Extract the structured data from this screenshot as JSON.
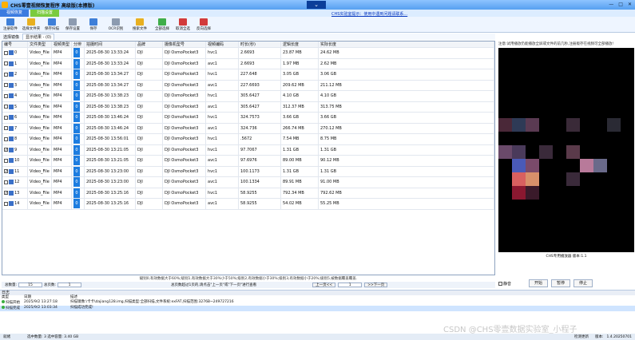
{
  "window": {
    "title": "CHS零壹视频恢复程序 高级版(本擦版)",
    "dropdown_glyph": "⌄",
    "controls": [
      "—",
      "□",
      "✕"
    ]
  },
  "menu": {
    "tabs": [
      "视频恢复",
      "扫描设置"
    ]
  },
  "notice": "CHS实验室提示：使用中遇到问题请联系...",
  "toolbar": {
    "buttons": [
      {
        "label": "注册软件",
        "icon": "key-icon",
        "color": "#3e7fd8"
      },
      {
        "label": "选择文件夹",
        "icon": "folder-icon",
        "color": "#e8b020"
      },
      {
        "label": "保存扫描",
        "icon": "save-icon",
        "color": "#3e7fd8"
      },
      {
        "label": "保存设置",
        "icon": "settings-icon",
        "color": "#8c9bb0"
      },
      {
        "label": "保存",
        "icon": "disk-icon",
        "color": "#3e7fd8"
      },
      {
        "label": "OCR识别",
        "icon": "ocr-icon",
        "color": "#8c9bb0"
      },
      {
        "label": "搜索文件",
        "icon": "search-icon",
        "color": "#e8b020"
      },
      {
        "label": "全部选择",
        "icon": "check-all-icon",
        "color": "#3fae4a"
      },
      {
        "label": "取消全选",
        "icon": "uncheck-icon",
        "color": "#d23b3b"
      },
      {
        "label": "反向选择",
        "icon": "invert-icon",
        "color": "#d23b3b"
      }
    ]
  },
  "subtabs": [
    "选择镜像",
    "显示结果 - (0)"
  ],
  "table": {
    "columns": [
      "编号",
      "文件类型",
      "视频类型",
      "分辨",
      "拍摄时间",
      "品牌",
      "摄像机型号",
      "视频编码",
      "时长(秒)",
      "逻辑长度",
      "实际长度"
    ],
    "rows": [
      {
        "id": "0",
        "checked": false,
        "ftype": "Video_File",
        "vtype": "MP4",
        "res": "0",
        "time": "2025-08-30 13:33:24",
        "brand": "DJI",
        "model": "DJI OsmoPocket3",
        "codec": "hvc1",
        "dur": "2.6693",
        "logical": "23.87 MB",
        "actual": "24.62 MB"
      },
      {
        "id": "1",
        "checked": false,
        "ftype": "Video_File",
        "vtype": "MP4",
        "res": "0",
        "time": "2025-08-30 13:33:24",
        "brand": "DJI",
        "model": "DJI OsmoPocket3",
        "codec": "avc1",
        "dur": "2.6693",
        "logical": "1.97 MB",
        "actual": "2.62 MB"
      },
      {
        "id": "2",
        "checked": false,
        "ftype": "Video_File",
        "vtype": "MP4",
        "res": "0",
        "time": "2025-08-30 13:34:27",
        "brand": "DJI",
        "model": "DJI OsmoPocket3",
        "codec": "hvc1",
        "dur": "227.648",
        "logical": "3.05 GB",
        "actual": "3.06 GB"
      },
      {
        "id": "3",
        "checked": false,
        "ftype": "Video_File",
        "vtype": "MP4",
        "res": "0",
        "time": "2025-08-30 13:34:27",
        "brand": "DJI",
        "model": "DJI OsmoPocket3",
        "codec": "avc1",
        "dur": "227.6693",
        "logical": "209.62 MB",
        "actual": "211.12 MB"
      },
      {
        "id": "4",
        "checked": false,
        "ftype": "Video_File",
        "vtype": "MP4",
        "res": "0",
        "time": "2025-08-30 13:38:23",
        "brand": "DJI",
        "model": "DJI OsmoPocket3",
        "codec": "hvc1",
        "dur": "305.6427",
        "logical": "4.10 GB",
        "actual": "4.10 GB"
      },
      {
        "id": "5",
        "checked": false,
        "ftype": "Video_File",
        "vtype": "MP4",
        "res": "0",
        "time": "2025-08-30 13:38:23",
        "brand": "DJI",
        "model": "DJI OsmoPocket3",
        "codec": "avc1",
        "dur": "305.6427",
        "logical": "312.37 MB",
        "actual": "313.75 MB"
      },
      {
        "id": "6",
        "checked": false,
        "ftype": "Video_File",
        "vtype": "MP4",
        "res": "0",
        "time": "2025-08-30 13:46:24",
        "brand": "DJI",
        "model": "DJI OsmoPocket3",
        "codec": "hvc1",
        "dur": "324.7573",
        "logical": "3.66 GB",
        "actual": "3.66 GB"
      },
      {
        "id": "7",
        "checked": false,
        "ftype": "Video_File",
        "vtype": "MP4",
        "res": "0",
        "time": "2025-08-30 13:46:24",
        "brand": "DJI",
        "model": "DJI OsmoPocket3",
        "codec": "avc1",
        "dur": "324.736",
        "logical": "266.74 MB",
        "actual": "270.12 MB"
      },
      {
        "id": "8",
        "checked": false,
        "ftype": "Video_File",
        "vtype": "MP4",
        "res": "0",
        "time": "2025-08-30 13:56:01",
        "brand": "DJI",
        "model": "DJI OsmoPocket3",
        "codec": "hvc1",
        "dur": ".5672",
        "logical": "7.54 MB",
        "actual": "8.75 MB"
      },
      {
        "id": "9",
        "checked": true,
        "ftype": "Video_File",
        "vtype": "MP4",
        "res": "0",
        "time": "2025-08-30 13:21:05",
        "brand": "DJI",
        "model": "DJI OsmoPocket3",
        "codec": "hvc1",
        "dur": "97.7067",
        "logical": "1.31 GB",
        "actual": "1.31 GB"
      },
      {
        "id": "10",
        "checked": false,
        "ftype": "Video_File",
        "vtype": "MP4",
        "res": "0",
        "time": "2025-08-30 13:21:05",
        "brand": "DJI",
        "model": "DJI OsmoPocket3",
        "codec": "avc1",
        "dur": "97.6976",
        "logical": "89.00 MB",
        "actual": "90.12 MB"
      },
      {
        "id": "11",
        "checked": true,
        "ftype": "Video_File",
        "vtype": "MP4",
        "res": "0",
        "time": "2025-08-30 13:23:00",
        "brand": "DJI",
        "model": "DJI OsmoPocket3",
        "codec": "hvc1",
        "dur": "100.1173",
        "logical": "1.31 GB",
        "actual": "1.31 GB"
      },
      {
        "id": "12",
        "checked": false,
        "ftype": "Video_File",
        "vtype": "MP4",
        "res": "0",
        "time": "2025-08-30 13:23:00",
        "brand": "DJI",
        "model": "DJI OsmoPocket3",
        "codec": "avc1",
        "dur": "100.1334",
        "logical": "89.91 MB",
        "actual": "91.00 MB"
      },
      {
        "id": "13",
        "checked": true,
        "ftype": "Video_File",
        "vtype": "MP4",
        "res": "0",
        "time": "2025-08-30 13:25:16",
        "brand": "DJI",
        "model": "DJI OsmoPocket3",
        "codec": "hvc1",
        "dur": "58.9255",
        "logical": "792.34 MB",
        "actual": "792.62 MB"
      },
      {
        "id": "14",
        "checked": false,
        "ftype": "Video_File",
        "vtype": "MP4",
        "res": "0",
        "time": "2025-08-30 13:25:16",
        "brand": "DJI",
        "model": "DJI OsmoPocket3",
        "codec": "avc1",
        "dur": "58.9255",
        "logical": "54.02 MB",
        "actual": "55.25 MB"
      }
    ]
  },
  "info_text": "級别0,有效数据大于60%;级别1,有效数据大于30%小于50%;级别2,有效数据小于30%;级别3,有效数据小于20%;级别5,被数据覆盖覆盖.",
  "pager": {
    "total_label": "总数量:",
    "total_value": "15",
    "pages_label": "总页数:",
    "pages_value": "1",
    "hint": "总页数超过1页的,请点击\"上一页\"或\"下一页\"进行查看",
    "prev_label": "上一页<<",
    "page_input": "1",
    "next_label": ">>下一页"
  },
  "preview": {
    "hint": "注意:试用播放仍能播放全屏或文件的前几秒,注册版存在视频可全部播放!",
    "caption": "CHS专用播放器 版本:1.1",
    "mute_label": "静音",
    "buttons": [
      "开始",
      "暂停",
      "停止"
    ]
  },
  "log": {
    "title": "日志",
    "columns": [
      "类型",
      "日期",
      "描述"
    ],
    "rows": [
      {
        "type": "扫描开始",
        "date": "2025/9/2 13:27:18",
        "desc": "扫描镜像:\\卡卡\\dajiang128.img,扫描类型:全部扫描,文件系统:exFAT,扫描范围:3276B~249727216"
      },
      {
        "type": "扫描完成",
        "date": "2025/9/2 13:03:34",
        "desc": "扫描成功完成!"
      }
    ]
  },
  "status": {
    "left_label": "就绪",
    "selection": "选中数量: 3 选中容量: 3.40 GB",
    "right_text": "检测更新",
    "version_label": "版本:",
    "version": "1.4.20250701"
  },
  "watermark": "CSDN @CHS零壹数据实验室_小程子"
}
